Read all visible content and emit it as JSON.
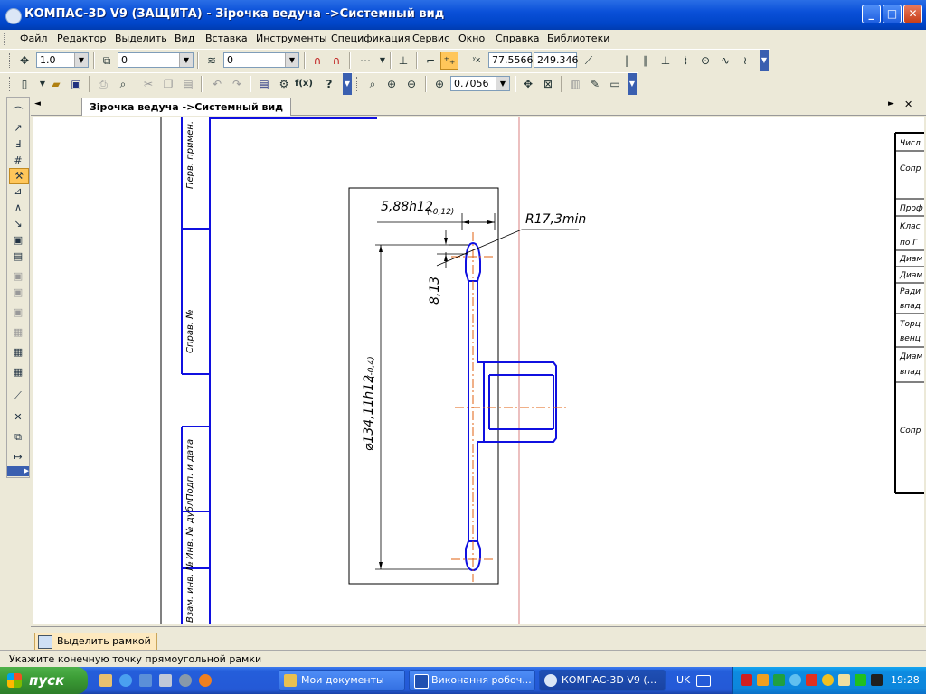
{
  "window": {
    "title": "КОМПАС-3D V9 (ЗАЩИТА) - Зірочка ведуча ->Системный вид",
    "min_glyph": "_",
    "max_glyph": "□",
    "close_glyph": "✕"
  },
  "menu": [
    "Файл",
    "Редактор",
    "Выделить",
    "Вид",
    "Вставка",
    "Инструменты",
    "Спецификация",
    "Сервис",
    "Окно",
    "Справка",
    "Библиотеки"
  ],
  "toolbar1": {
    "line_style_value": "1.0",
    "layer_value": "0",
    "view_value": "0",
    "coord_x": "77.5566",
    "coord_y": "249.346"
  },
  "toolbar2": {
    "fx_label": "f(x)",
    "zoom_value": "0.7056"
  },
  "tab": {
    "label": "Зірочка ведуча ->Системный вид",
    "nav_left": "◄",
    "nav_right": "►",
    "close": "✕"
  },
  "drawing": {
    "dim_width": "5,88h12",
    "dim_width_tol": "(-0,12)",
    "dim_radius": "R17,3min",
    "dim_height": "8,13",
    "dim_diameter": "⌀134,11h12",
    "dim_diameter_tol": "(-0,4)",
    "stamp_labels": [
      "Перв. примен.",
      "Справ. №",
      "Подп. и дата",
      "Инв. № дубл.",
      "Взам. инв. №"
    ],
    "right_table_rows": [
      "Числ",
      "Сопр",
      "Проф",
      "Клас",
      "по Г",
      "Диам",
      "Диам",
      "Ради",
      "впад",
      "Торц",
      "венц",
      "Диам",
      "впад",
      "Сопр"
    ]
  },
  "bottom": {
    "select_frame_label": "Выделить рамкой"
  },
  "status": {
    "message": "Укажите конечную точку прямоугольной рамки"
  },
  "taskbar": {
    "start_label": "пуск",
    "tasks": [
      "Мои документы",
      "Виконання робоч...",
      "КОМПАС-3D V9 (..."
    ],
    "lang": "UK",
    "clock": "19:28"
  },
  "colors": {
    "drawing_blue": "#1010e0",
    "axis_orange": "#e06010",
    "title_blue": "#0a50d8"
  }
}
